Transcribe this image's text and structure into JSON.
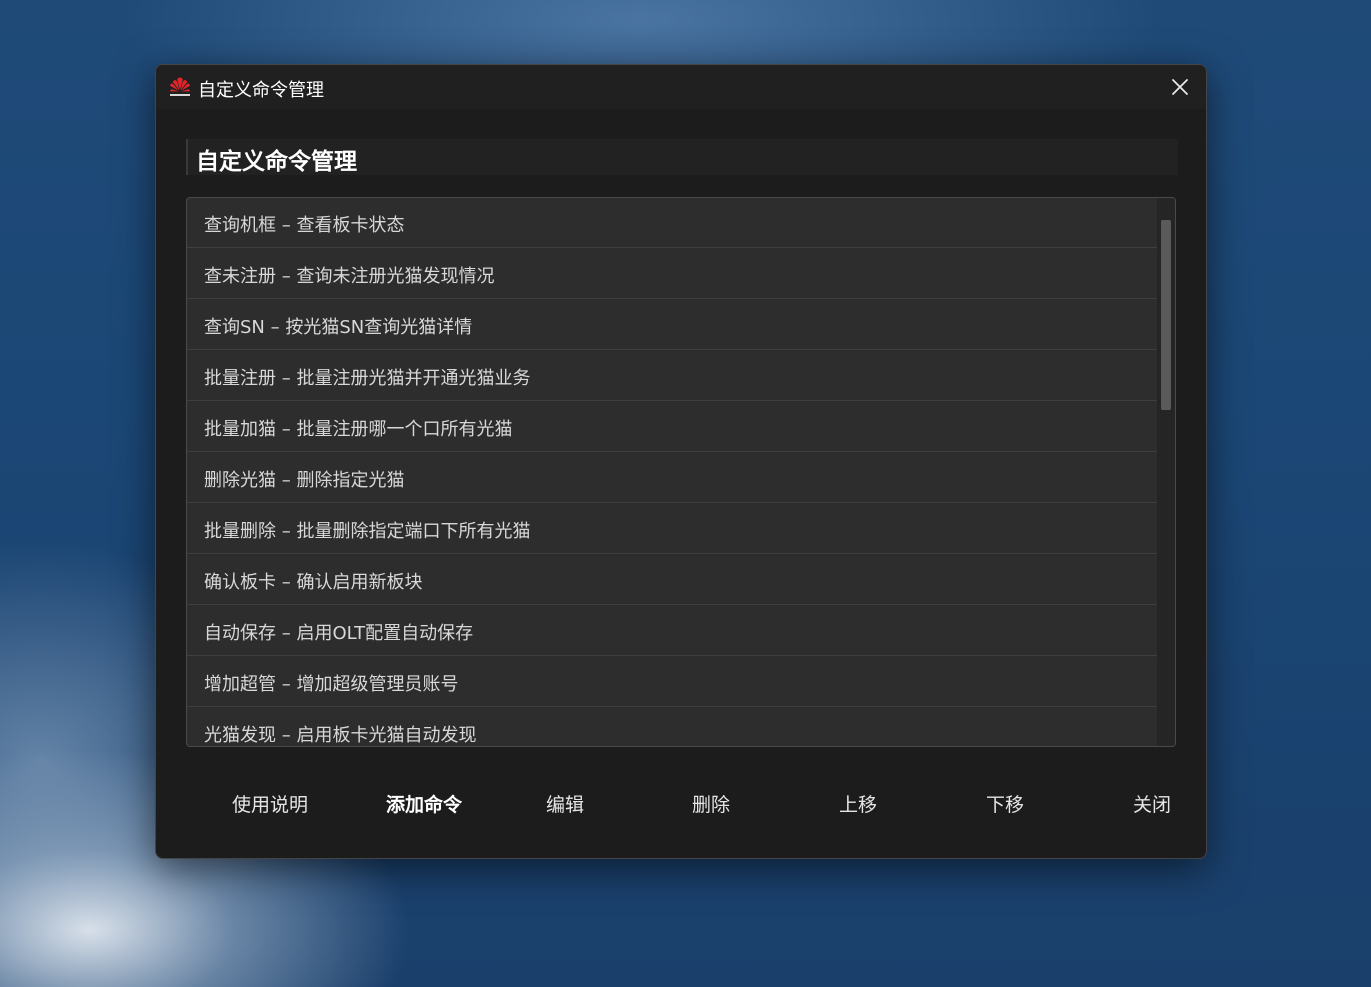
{
  "window": {
    "title": "自定义命令管理",
    "close_icon": "close-icon",
    "logo": "huawei-logo"
  },
  "header": {
    "title": "自定义命令管理"
  },
  "commands": [
    {
      "label": "查询机框 – 查看板卡状态"
    },
    {
      "label": "查未注册 – 查询未注册光猫发现情况"
    },
    {
      "label": "查询SN – 按光猫SN查询光猫详情"
    },
    {
      "label": "批量注册 – 批量注册光猫并开通光猫业务"
    },
    {
      "label": "批量加猫 – 批量注册哪一个口所有光猫"
    },
    {
      "label": "删除光猫 – 删除指定光猫"
    },
    {
      "label": "批量删除 – 批量删除指定端口下所有光猫"
    },
    {
      "label": "确认板卡 – 确认启用新板块"
    },
    {
      "label": "自动保存 – 启用OLT配置自动保存"
    },
    {
      "label": "增加超管 – 增加超级管理员账号"
    },
    {
      "label": "光猫发现 – 启用板卡光猫自动发现"
    }
  ],
  "buttons": {
    "help": "使用说明",
    "add": "添加命令",
    "edit": "编辑",
    "delete": "删除",
    "move_up": "上移",
    "move_down": "下移",
    "close": "关闭"
  },
  "colors": {
    "window_bg": "#1c1c1c",
    "list_bg": "#2d2d2d",
    "logo_red": "#e0262b"
  }
}
